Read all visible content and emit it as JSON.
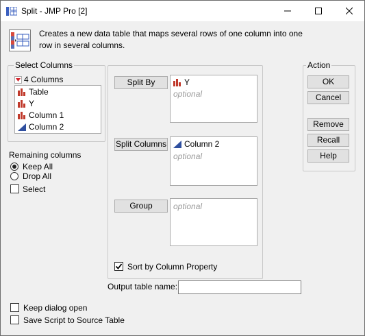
{
  "window": {
    "title": "Split - JMP Pro [2]"
  },
  "description": {
    "line1": "Creates a new data table that maps several rows of one column into one",
    "line2": "row in several columns."
  },
  "select_columns": {
    "heading": "Select Columns",
    "count_label": "4 Columns",
    "items": [
      {
        "label": "Table",
        "icon": "nominal-bar-icon"
      },
      {
        "label": "Y",
        "icon": "nominal-bar-icon"
      },
      {
        "label": "Column 1",
        "icon": "nominal-bar-icon"
      },
      {
        "label": "Column 2",
        "icon": "continuous-triangle-icon"
      }
    ]
  },
  "remaining": {
    "heading": "Remaining columns",
    "keep_all": "Keep All",
    "drop_all": "Drop All",
    "selected": "keep_all",
    "select_label": "Select"
  },
  "roles": {
    "split_by": {
      "button": "Split By",
      "value": "Y",
      "placeholder": "optional"
    },
    "split_columns": {
      "button": "Split Columns",
      "value": "Column 2",
      "placeholder": "optional"
    },
    "group": {
      "button": "Group",
      "placeholder": "optional"
    },
    "sort_label": "Sort by Column Property",
    "sort_checked": true
  },
  "output": {
    "label": "Output table name:",
    "value": ""
  },
  "action": {
    "heading": "Action",
    "ok": "OK",
    "cancel": "Cancel",
    "remove": "Remove",
    "recall": "Recall",
    "help": "Help"
  },
  "footer": {
    "keep_open": "Keep dialog open",
    "save_script": "Save Script to Source Table"
  },
  "colors": {
    "nominal_icon": "#c0392b",
    "continuous_icon": "#2f4f9f",
    "red_arrow": "#d4232b"
  }
}
